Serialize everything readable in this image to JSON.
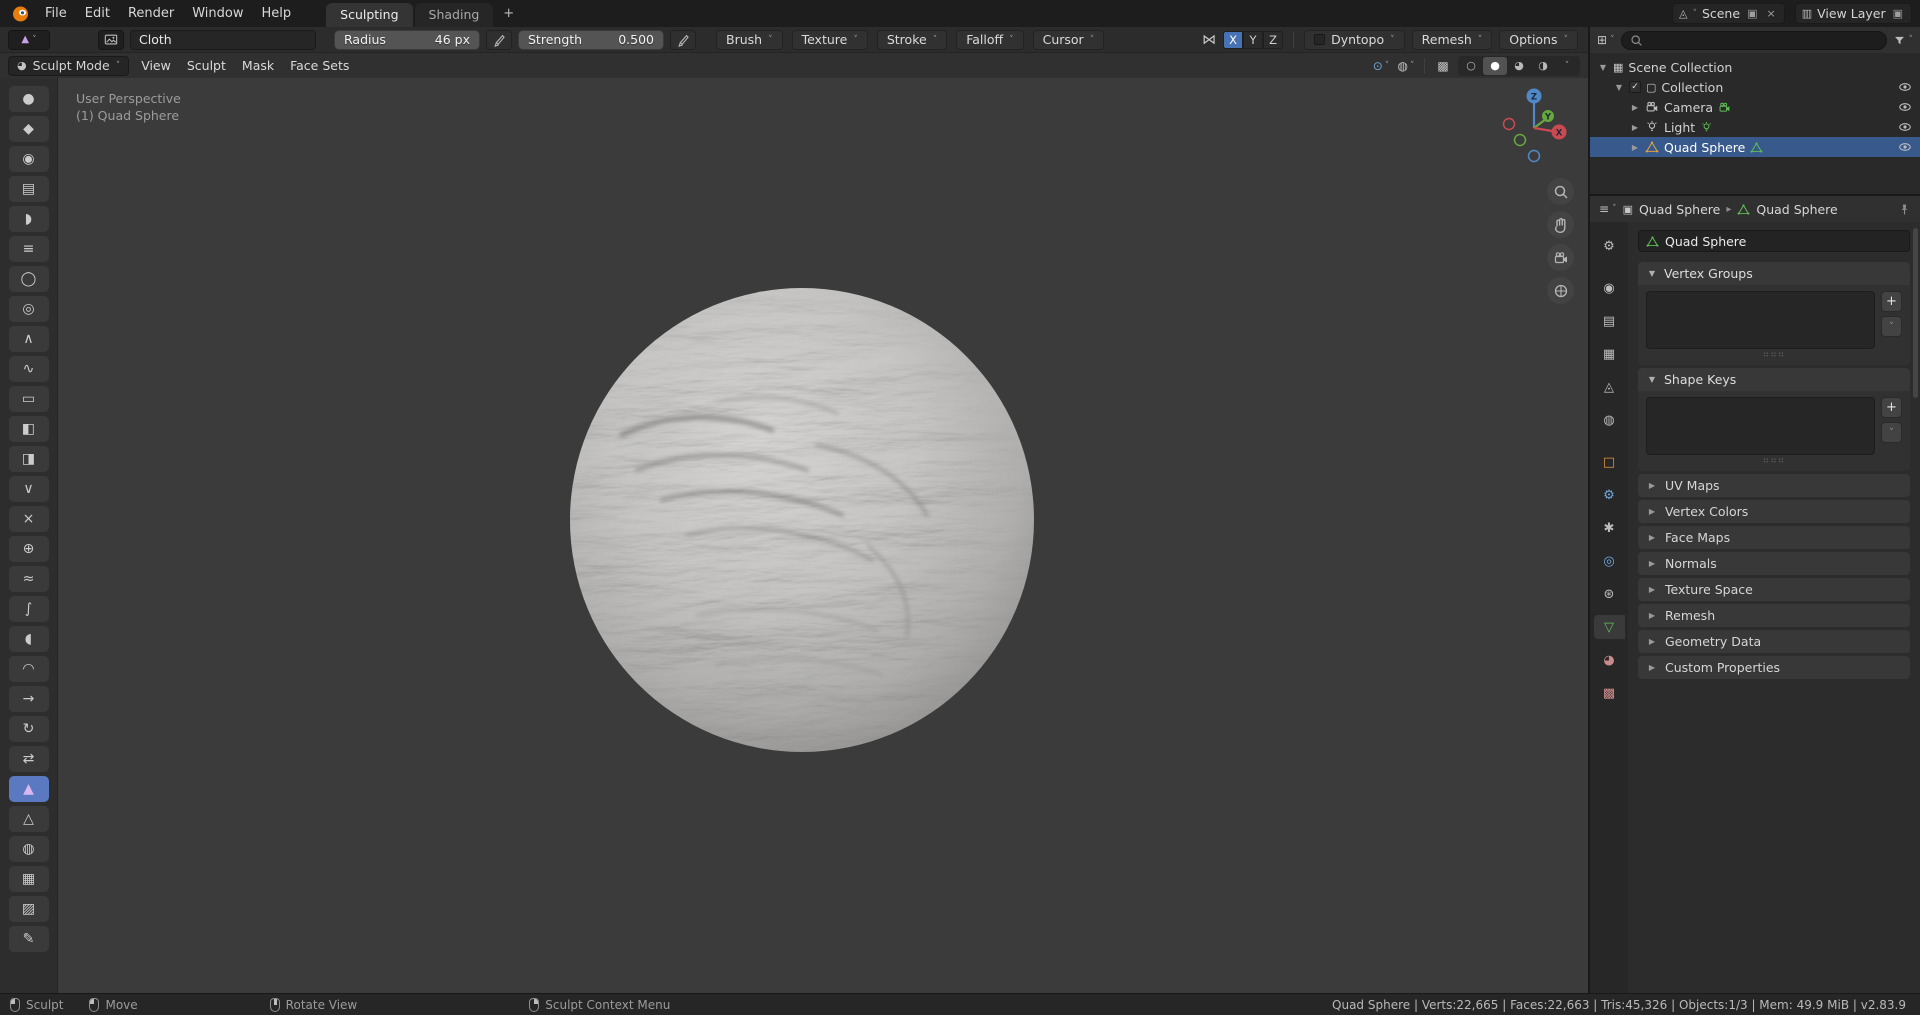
{
  "icons": {
    "chevron_down": "˅",
    "arrow_right": "▸",
    "arrow_expanded": "▼",
    "arrow_collapsed": "▶",
    "mirror": "⋈",
    "check": "✓",
    "scene": "◬",
    "duplicate": "▣",
    "close": "×",
    "view_layer": "▥",
    "outliner_editor": "⊞",
    "properties_editor": "≡",
    "mode_icon": "◕",
    "gizmos": "⊙",
    "overlays": "◍",
    "xray": "▩",
    "shade_wire": "○",
    "shade_solid": "●",
    "shade_material": "◕",
    "shade_render": "◑",
    "scene_collection": "▦",
    "collection": "▢",
    "breadcrumb_object": "▣",
    "active_tool_glyph": "▲",
    "grip": "⠶⠶⠶"
  },
  "topbar": {
    "menus": [
      {
        "name": "menu-file",
        "label": "File"
      },
      {
        "name": "menu-edit",
        "label": "Edit"
      },
      {
        "name": "menu-render",
        "label": "Render"
      },
      {
        "name": "menu-window",
        "label": "Window"
      },
      {
        "name": "menu-help",
        "label": "Help"
      }
    ],
    "workspace_tabs": [
      {
        "name": "workspace-tab-sculpting",
        "label": "Sculpting",
        "active": true
      },
      {
        "name": "workspace-tab-shading",
        "label": "Shading",
        "active": false
      }
    ],
    "new_workspace_label": "+",
    "scene_label": "Scene",
    "view_layer_label": "View Layer"
  },
  "tool_settings": {
    "brush_name": "Cloth",
    "radius_label": "Radius",
    "radius_value": "46 px",
    "strength_label": "Strength",
    "strength_value": "0.500",
    "menus": [
      {
        "name": "brush-menu",
        "label": "Brush"
      },
      {
        "name": "texture-menu",
        "label": "Texture"
      },
      {
        "name": "stroke-menu",
        "label": "Stroke"
      },
      {
        "name": "falloff-menu",
        "label": "Falloff"
      },
      {
        "name": "cursor-menu",
        "label": "Cursor"
      }
    ],
    "symmetry_x": "X",
    "symmetry_y": "Y",
    "symmetry_z": "Z",
    "dyntopo_label": "Dyntopo",
    "remesh_label": "Remesh",
    "options_label": "Options"
  },
  "viewport_header": {
    "mode_label": "Sculpt Mode",
    "menus": [
      {
        "name": "view-menu",
        "label": "View"
      },
      {
        "name": "sculpt-menu",
        "label": "Sculpt"
      },
      {
        "name": "mask-menu",
        "label": "Mask"
      },
      {
        "name": "face-sets-menu",
        "label": "Face Sets"
      }
    ]
  },
  "viewport": {
    "overlay_line1": "User Perspective",
    "overlay_line2": "(1) Quad Sphere",
    "axis_x": "X",
    "axis_y": "Y",
    "axis_z": "Z"
  },
  "toolbar": {
    "tools": [
      {
        "name": "tool-draw",
        "glyph": "●",
        "color": "#cccccc"
      },
      {
        "name": "tool-draw-sharp",
        "glyph": "◆",
        "color": "#cccccc"
      },
      {
        "name": "tool-clay",
        "glyph": "◉",
        "color": "#cccccc"
      },
      {
        "name": "tool-clay-strips",
        "glyph": "▤",
        "color": "#cccccc"
      },
      {
        "name": "tool-clay-thumb",
        "glyph": "◗",
        "color": "#cccccc"
      },
      {
        "name": "tool-layer",
        "glyph": "≡",
        "color": "#cccccc"
      },
      {
        "name": "tool-inflate",
        "glyph": "◯",
        "color": "#cccccc"
      },
      {
        "name": "tool-blob",
        "glyph": "◎",
        "color": "#cccccc"
      },
      {
        "name": "tool-crease",
        "glyph": "∧",
        "color": "#cccccc"
      },
      {
        "name": "tool-smooth",
        "glyph": "∿",
        "color": "#cccccc"
      },
      {
        "name": "tool-flatten",
        "glyph": "▭",
        "color": "#cccccc"
      },
      {
        "name": "tool-fill",
        "glyph": "◧",
        "color": "#cccccc"
      },
      {
        "name": "tool-scrape",
        "glyph": "◨",
        "color": "#cccccc"
      },
      {
        "name": "tool-multiplane-scrape",
        "glyph": "∨",
        "color": "#cccccc"
      },
      {
        "name": "tool-pinch",
        "glyph": "×",
        "color": "#cccccc"
      },
      {
        "name": "tool-grab",
        "glyph": "⊕",
        "color": "#cccccc"
      },
      {
        "name": "tool-elastic-deform",
        "glyph": "≈",
        "color": "#cccccc"
      },
      {
        "name": "tool-snake-hook",
        "glyph": "∫",
        "color": "#cccccc"
      },
      {
        "name": "tool-thumb",
        "glyph": "◖",
        "color": "#cccccc"
      },
      {
        "name": "tool-pose",
        "glyph": "◠",
        "color": "#cccccc"
      },
      {
        "name": "tool-nudge",
        "glyph": "→",
        "color": "#cccccc"
      },
      {
        "name": "tool-rotate",
        "glyph": "↻",
        "color": "#cccccc"
      },
      {
        "name": "tool-slide-relax",
        "glyph": "⇄",
        "color": "#cccccc"
      },
      {
        "name": "tool-cloth",
        "glyph": "▲",
        "color": "#d9b8f2",
        "active": true
      },
      {
        "name": "tool-simplify",
        "glyph": "△",
        "color": "#cccccc"
      },
      {
        "name": "tool-mask",
        "glyph": "◍",
        "color": "#cccccc"
      },
      {
        "name": "tool-draw-face-sets",
        "glyph": "▦",
        "color": "#cccccc"
      },
      {
        "name": "tool-box-mask",
        "glyph": "▨",
        "color": "#cccccc"
      },
      {
        "name": "tool-annotate",
        "glyph": "✎",
        "color": "#cccccc"
      }
    ]
  },
  "outliner": {
    "search_value": "",
    "rows": [
      {
        "label": "Scene Collection"
      },
      {
        "label": "Collection"
      },
      {
        "label": "Camera"
      },
      {
        "label": "Light"
      },
      {
        "label": "Quad Sphere"
      }
    ]
  },
  "properties": {
    "breadcrumb_object": "Quad Sphere",
    "breadcrumb_data": "Quad Sphere",
    "name_value": "Quad Sphere",
    "tabs": [
      {
        "name": "tab-tool",
        "glyph": "⚙",
        "color": "#bdbdbd"
      },
      {
        "name": "tab-render",
        "glyph": "◉",
        "color": "#bdbdbd",
        "gap_before": true
      },
      {
        "name": "tab-output",
        "glyph": "▤",
        "color": "#bdbdbd"
      },
      {
        "name": "tab-view-layer",
        "glyph": "▦",
        "color": "#bdbdbd"
      },
      {
        "name": "tab-scene",
        "glyph": "◬",
        "color": "#bdbdbd"
      },
      {
        "name": "tab-world",
        "glyph": "◍",
        "color": "#bdbdbd"
      },
      {
        "name": "tab-object",
        "glyph": "□",
        "color": "#e0973f",
        "gap_before": true
      },
      {
        "name": "tab-modifiers",
        "glyph": "⚙",
        "color": "#71a8e0"
      },
      {
        "name": "tab-particles",
        "glyph": "✱",
        "color": "#bdbdbd"
      },
      {
        "name": "tab-physics",
        "glyph": "◎",
        "color": "#71a8e0"
      },
      {
        "name": "tab-constraints",
        "glyph": "⊛",
        "color": "#bdbdbd"
      },
      {
        "name": "tab-object-data",
        "glyph": "▽",
        "color": "#5cc05c",
        "active": true
      },
      {
        "name": "tab-material",
        "glyph": "◕",
        "color": "#c98a8a"
      },
      {
        "name": "tab-texture",
        "glyph": "▩",
        "color": "#cf8d8d"
      }
    ],
    "vertex_groups_label": "Vertex Groups",
    "shape_keys_label": "Shape Keys",
    "add_label": "+",
    "collapsed_panels": [
      {
        "name": "panel-uv-maps",
        "label": "UV Maps"
      },
      {
        "name": "panel-vertex-colors",
        "label": "Vertex Colors"
      },
      {
        "name": "panel-face-maps",
        "label": "Face Maps"
      },
      {
        "name": "panel-normals",
        "label": "Normals"
      },
      {
        "name": "panel-texture-space",
        "label": "Texture Space"
      },
      {
        "name": "panel-remesh",
        "label": "Remesh"
      },
      {
        "name": "panel-geometry-data",
        "label": "Geometry Data"
      },
      {
        "name": "panel-custom-properties",
        "label": "Custom Properties"
      }
    ]
  },
  "status": {
    "hints": [
      {
        "name": "hint-sculpt",
        "button": "lmb",
        "label": "Sculpt"
      },
      {
        "name": "hint-move",
        "button": "lmb",
        "label": "Move"
      },
      {
        "name": "hint-rotate-view",
        "button": "mmb",
        "label": "Rotate View"
      },
      {
        "name": "hint-context-menu",
        "button": "rmb",
        "label": "Sculpt Context Menu"
      }
    ],
    "stats": "Quad Sphere | Verts:22,665 | Faces:22,663 | Tris:45,326 | Objects:1/3 | Mem: 49.9 MiB | v2.83.9"
  }
}
